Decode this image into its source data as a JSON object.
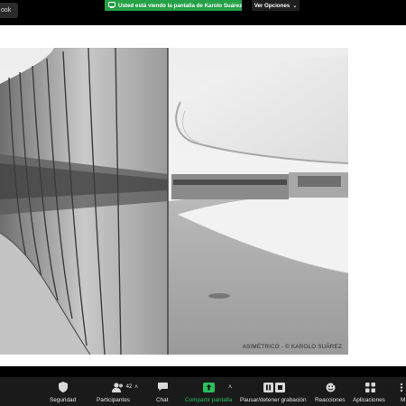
{
  "top_bar": {
    "tab_fragment": "ook",
    "sharing_banner": "Usted está viendo la pantalla de Karolo Suárez",
    "view_options_label": "Ver Opciones"
  },
  "shared_image": {
    "credit": "ASIMÉTRICO - © KAROLO SUÁREZ"
  },
  "toolbar": {
    "security_label": "Seguridad",
    "participants_label": "Participantes",
    "participants_count": "42",
    "chat_label": "Chat",
    "share_screen_label": "Compartir pantalla",
    "pause_record_label": "Pausar/detener grabación",
    "reactions_label": "Reacciones",
    "apps_label": "Aplicaciones",
    "more_fragment": "M"
  },
  "colors": {
    "share_green": "#24a046",
    "toolbar_bg": "#1a1a1a",
    "label": "#e6e6e6"
  }
}
